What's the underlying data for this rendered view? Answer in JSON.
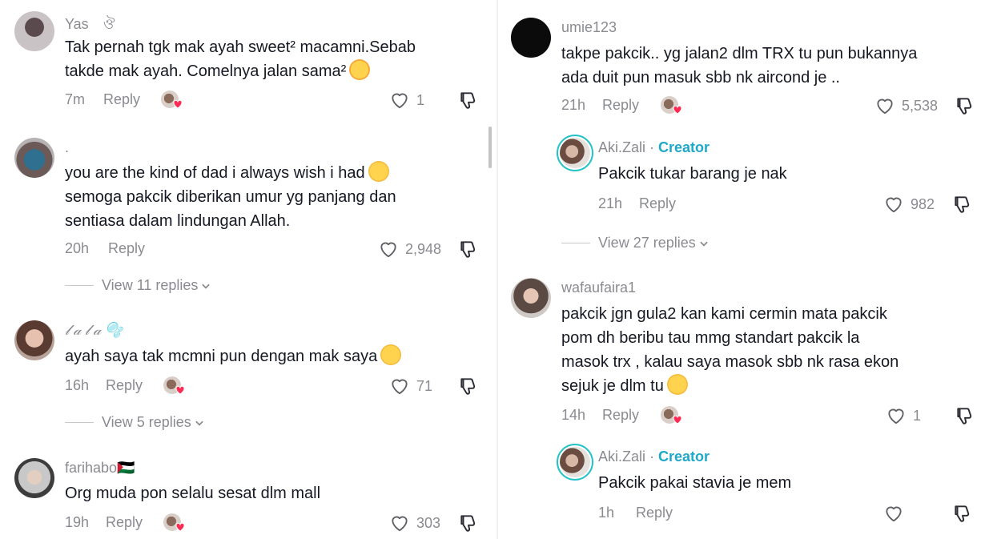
{
  "left": {
    "comments": [
      {
        "username": "Yas ⠀ঔ",
        "text_lines": [
          "Tak pernah tgk mak ayah sweet² macamni.Sebab",
          "takde mak ayah. Comelnya jalan sama²"
        ],
        "time": "7m",
        "reply": "Reply",
        "likes": "1"
      },
      {
        "username": ".",
        "text_lines": [
          "you are the kind of dad i always wish i had",
          "semoga pakcik diberikan umur yg panjang dan",
          "sentiasa dalam lindungan Allah."
        ],
        "time": "20h",
        "reply": "Reply",
        "likes": "2,948",
        "view_replies": "View 11 replies"
      },
      {
        "username": "𝓁 𝒶 𝓁 𝒶 🫧",
        "text_lines": [
          "ayah saya tak mcmni pun dengan mak saya"
        ],
        "time": "16h",
        "reply": "Reply",
        "likes": "71",
        "view_replies": "View 5 replies"
      },
      {
        "username": "farihabo🇵🇸",
        "text_lines": [
          "Org muda pon selalu sesat dlm mall"
        ],
        "time": "19h",
        "reply": "Reply",
        "likes": "303"
      }
    ]
  },
  "right": {
    "comments": [
      {
        "username": "umie123",
        "text_lines": [
          "takpe pakcik.. yg jalan2 dlm TRX tu pun bukannya",
          "ada duit pun  masuk sbb nk aircond je .."
        ],
        "time": "21h",
        "reply": "Reply",
        "likes": "5,538"
      },
      {
        "username": "Aki.Zali",
        "creator_label": "Creator",
        "text_lines": [
          "Pakcik tukar barang je nak"
        ],
        "time": "21h",
        "reply": "Reply",
        "likes": "982",
        "view_replies": "View 27 replies"
      },
      {
        "username": "wafaufaira1",
        "text_lines": [
          "pakcik jgn gula2 kan kami  cermin mata pakcik",
          "pom dh beribu tau  mmg standart pakcik la",
          "masok trx , kalau saya masok sbb nk rasa ekon",
          "sejuk je dlm tu"
        ],
        "time": "14h",
        "reply": "Reply",
        "likes": "1"
      },
      {
        "username": "Aki.Zali",
        "creator_label": "Creator",
        "text_lines": [
          "Pakcik pakai stavia je mem"
        ],
        "time": "1h",
        "reply": "Reply",
        "likes": ""
      }
    ]
  },
  "icons": {
    "heart": "heart-outline-icon",
    "dislike": "thumbs-down-icon",
    "chevron": "chevron-down-icon"
  },
  "colors": {
    "creator": "#20a8c9",
    "muted": "#8a8b91",
    "text": "#161823",
    "ring": "#25c2c9"
  }
}
